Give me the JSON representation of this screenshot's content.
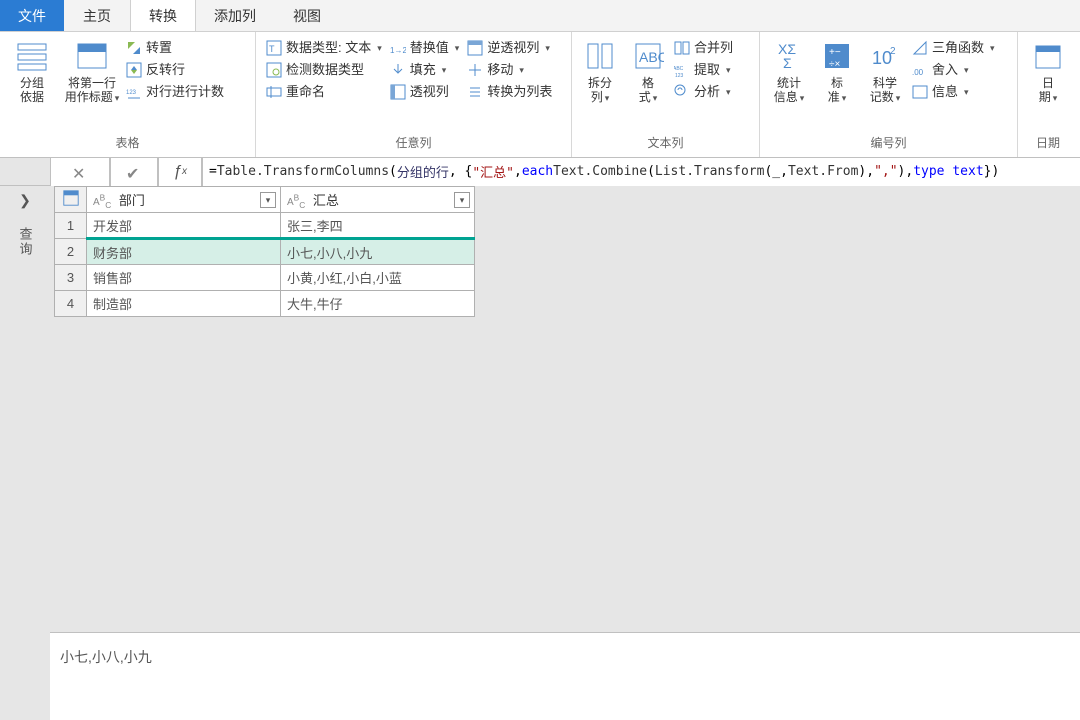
{
  "tabs": {
    "file": "文件",
    "home": "主页",
    "transform": "转换",
    "addcol": "添加列",
    "view": "视图"
  },
  "ribbon": {
    "group_table": {
      "label": "表格",
      "groupby_l1": "分组",
      "groupby_l2": "依据",
      "usefirst_l1": "将第一行",
      "usefirst_l2": "用作标题",
      "transpose": "转置",
      "reverse": "反转行",
      "countrows": "对行进行计数"
    },
    "group_anycol": {
      "label": "任意列",
      "datatype": "数据类型: 文本",
      "detect": "检测数据类型",
      "rename": "重命名",
      "replace": "替换值",
      "fill": "填充",
      "pivot": "透视列",
      "unpivot": "逆透视列",
      "move": "移动",
      "tolist": "转换为列表"
    },
    "group_textcol": {
      "label": "文本列",
      "split_l1": "拆分",
      "split_l2": "列",
      "format_l1": "格",
      "format_l2": "式",
      "merge": "合并列",
      "extract": "提取",
      "analyze": "分析"
    },
    "group_numcol": {
      "label": "编号列",
      "stats_l1": "统计",
      "stats_l2": "信息",
      "standard_l1": "标",
      "standard_l2": "准",
      "scinot_l1": "科学",
      "scinot_l2": "记数",
      "trig": "三角函数",
      "rounding": "舍入",
      "info": "信息"
    },
    "group_date": {
      "date_l1": "日",
      "date_l2": "期"
    }
  },
  "fx": {
    "prefix": "= ",
    "fn1": "Table.TransformColumns",
    "arg1": "分组的行",
    "col": "\"汇总\"",
    "each": "each",
    "fn2": "Text.Combine",
    "fn3": "List.Transform",
    "u": "_",
    "fn4": "Text.From",
    "sep": "\",\"",
    "type": "type text"
  },
  "grid": {
    "col1": "部门",
    "col2": "汇总",
    "typetag": "ABC",
    "rows": [
      {
        "no": "1",
        "c1": "开发部",
        "c2": "张三,李四"
      },
      {
        "no": "2",
        "c1": "财务部",
        "c2": "小七,小八,小九"
      },
      {
        "no": "3",
        "c1": "销售部",
        "c2": "小黄,小红,小白,小蓝"
      },
      {
        "no": "4",
        "c1": "制造部",
        "c2": "大牛,牛仔"
      }
    ]
  },
  "sidepanel": {
    "label": "查询"
  },
  "preview": "小七,小八,小九"
}
